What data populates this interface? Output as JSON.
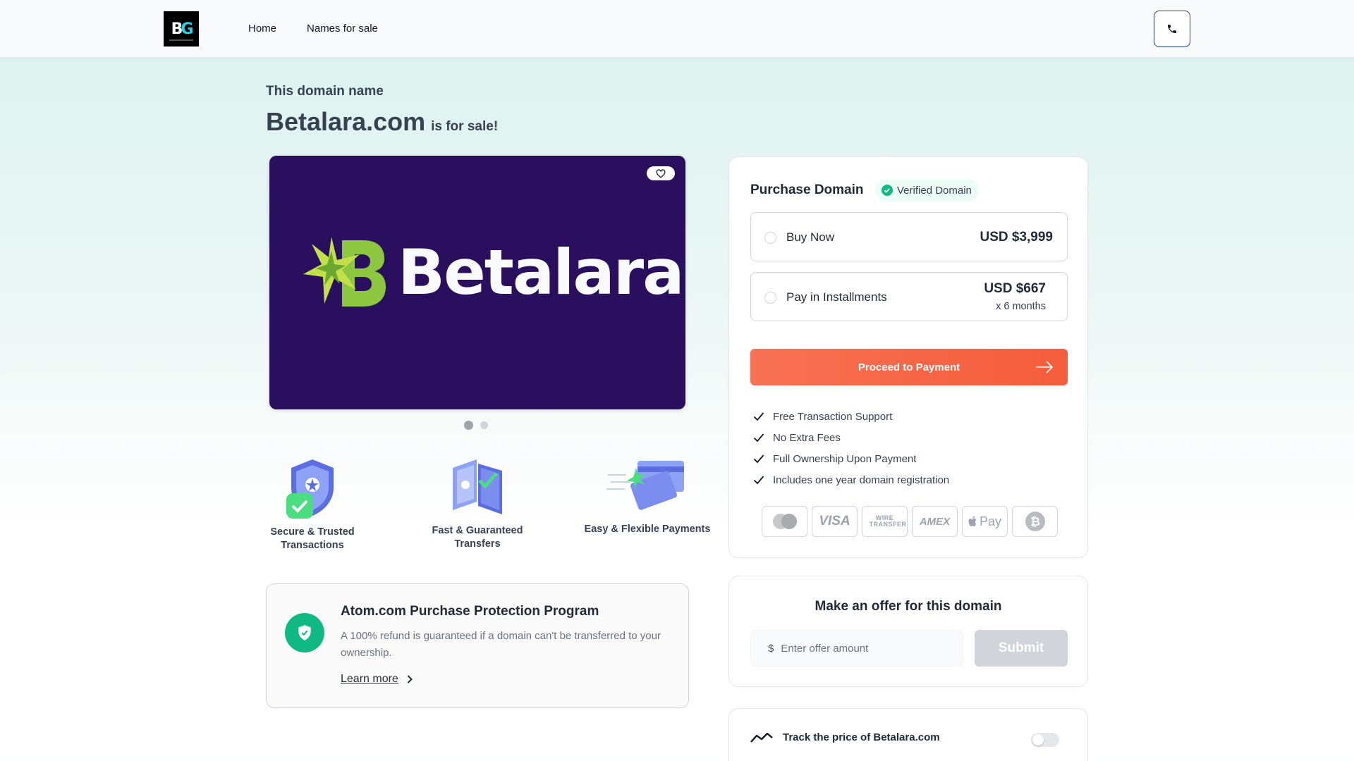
{
  "header": {
    "logo_alt": "BG",
    "nav": [
      {
        "label": "Home"
      },
      {
        "label": "Names for sale"
      }
    ],
    "phone_icon": "phone-icon"
  },
  "hero": {
    "eyebrow": "This domain name",
    "domain": "Betalara.com",
    "suffix": "is for sale!",
    "brand_word": "Betalara",
    "carousel_dots": 2,
    "active_dot": 1
  },
  "features": [
    {
      "label": "Secure & Trusted Transactions",
      "icon": "shield-icon"
    },
    {
      "label": "Fast & Guaranteed Transfers",
      "icon": "transfer-icon"
    },
    {
      "label": "Easy & Flexible Payments",
      "icon": "credit-card-icon"
    }
  ],
  "protection": {
    "title": "Atom.com Purchase Protection Program",
    "text": "A 100% refund is guaranteed if a domain can't be transferred to your ownership.",
    "link": "Learn more"
  },
  "purchase": {
    "title": "Purchase Domain",
    "verified": "Verified Domain",
    "options": [
      {
        "name": "Buy Now",
        "price": "USD $3,999"
      },
      {
        "name": "Pay in Installments",
        "price": "USD $667",
        "term": "x 6 months"
      }
    ],
    "cta": "Proceed to Payment",
    "benefits": [
      "Free Transaction Support",
      "No Extra Fees",
      "Full Ownership Upon Payment",
      "Includes one year domain registration"
    ],
    "payment_methods": [
      "mastercard-icon",
      "VISA",
      "WIRE TRANSFER",
      "AMEX",
      "Pay",
      "bitcoin-icon"
    ]
  },
  "offer": {
    "title": "Make an offer for this domain",
    "currency": "$",
    "placeholder": "Enter offer amount",
    "submit": "Submit"
  },
  "track": {
    "label": "Track the price of Betalara.com",
    "enabled": false
  },
  "colors": {
    "accent": "#f55d3b",
    "verified_green": "#10b981",
    "hero_bg": "#2a0f5e"
  }
}
